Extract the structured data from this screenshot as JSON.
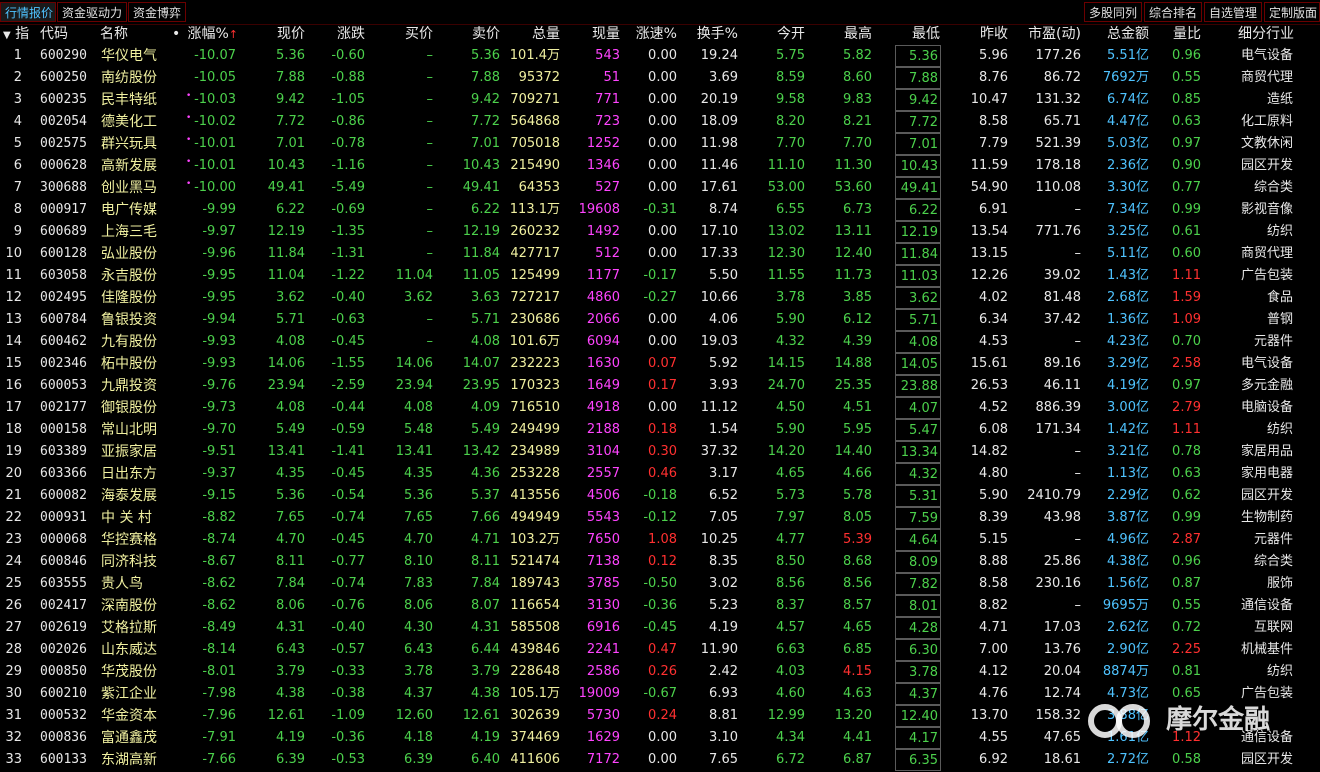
{
  "tabs_left": [
    {
      "label": "行情报价",
      "active": true
    },
    {
      "label": "资金驱动力",
      "active": false
    },
    {
      "label": "资金博弈",
      "active": false
    }
  ],
  "tabs_right": [
    {
      "label": "多股同列"
    },
    {
      "label": "综合排名"
    },
    {
      "label": "自选管理"
    },
    {
      "label": "定制版面"
    }
  ],
  "headers": {
    "idx": "指",
    "code": "代码",
    "name": "名称",
    "pct": "涨幅%",
    "price": "现价",
    "change": "涨跌",
    "bid": "买价",
    "ask": "卖价",
    "volume": "总量",
    "cur_vol": "现量",
    "speed": "涨速%",
    "turnover": "换手%",
    "open": "今开",
    "high": "最高",
    "low": "最低",
    "prev_close": "昨收",
    "pe": "市盈(动)",
    "amount": "总金额",
    "vol_ratio": "量比",
    "industry": "细分行业"
  },
  "sort_indicator": "↑",
  "rows": [
    {
      "idx": "1",
      "code": "600290",
      "name": "华仪电气",
      "pct": "-10.07",
      "price": "5.36",
      "change": "-0.60",
      "bid": "–",
      "ask": "5.36",
      "volume": "101.4万",
      "cur_vol": "543",
      "speed": "0.00",
      "turnover": "19.24",
      "open": "5.75",
      "high": "5.82",
      "low": "5.36",
      "prev_close": "5.96",
      "pe": "177.26",
      "amount_num": "5.51",
      "amount_unit": "亿",
      "vol_ratio": "0.96",
      "industry": "电气设备"
    },
    {
      "idx": "2",
      "code": "600250",
      "name": "南纺股份",
      "pct": "-10.05",
      "price": "7.88",
      "change": "-0.88",
      "bid": "–",
      "ask": "7.88",
      "volume": "95372",
      "cur_vol": "51",
      "speed": "0.00",
      "turnover": "3.69",
      "open": "8.59",
      "high": "8.60",
      "low": "7.88",
      "prev_close": "8.76",
      "pe": "86.72",
      "amount_num": "7692",
      "amount_unit": "万",
      "vol_ratio": "0.55",
      "industry": "商贸代理"
    },
    {
      "idx": "3",
      "code": "600235",
      "name": "民丰特纸",
      "pct": "-10.03",
      "price": "9.42",
      "change": "-1.05",
      "bid": "–",
      "ask": "9.42",
      "volume": "709271",
      "cur_vol": "771",
      "speed": "0.00",
      "turnover": "20.19",
      "open": "9.58",
      "high": "9.83",
      "low": "9.42",
      "prev_close": "10.47",
      "pe": "131.32",
      "amount_num": "6.74",
      "amount_unit": "亿",
      "vol_ratio": "0.85",
      "industry": "造纸"
    },
    {
      "idx": "4",
      "code": "002054",
      "name": "德美化工",
      "pct": "-10.02",
      "price": "7.72",
      "change": "-0.86",
      "bid": "–",
      "ask": "7.72",
      "volume": "564868",
      "cur_vol": "723",
      "speed": "0.00",
      "turnover": "18.09",
      "open": "8.20",
      "high": "8.21",
      "low": "7.72",
      "prev_close": "8.58",
      "pe": "65.71",
      "amount_num": "4.47",
      "amount_unit": "亿",
      "vol_ratio": "0.63",
      "industry": "化工原料"
    },
    {
      "idx": "5",
      "code": "002575",
      "name": "群兴玩具",
      "pct": "-10.01",
      "price": "7.01",
      "change": "-0.78",
      "bid": "–",
      "ask": "7.01",
      "volume": "705018",
      "cur_vol": "1252",
      "speed": "0.00",
      "turnover": "11.98",
      "open": "7.70",
      "high": "7.70",
      "low": "7.01",
      "prev_close": "7.79",
      "pe": "521.39",
      "amount_num": "5.03",
      "amount_unit": "亿",
      "vol_ratio": "0.97",
      "industry": "文教休闲"
    },
    {
      "idx": "6",
      "code": "000628",
      "name": "高新发展",
      "pct": "-10.01",
      "price": "10.43",
      "change": "-1.16",
      "bid": "–",
      "ask": "10.43",
      "volume": "215490",
      "cur_vol": "1346",
      "speed": "0.00",
      "turnover": "11.46",
      "open": "11.10",
      "high": "11.30",
      "low": "10.43",
      "prev_close": "11.59",
      "pe": "178.18",
      "amount_num": "2.36",
      "amount_unit": "亿",
      "vol_ratio": "0.90",
      "industry": "园区开发"
    },
    {
      "idx": "7",
      "code": "300688",
      "name": "创业黑马",
      "pct": "-10.00",
      "price": "49.41",
      "change": "-5.49",
      "bid": "–",
      "ask": "49.41",
      "volume": "64353",
      "cur_vol": "527",
      "speed": "0.00",
      "turnover": "17.61",
      "open": "53.00",
      "high": "53.60",
      "low": "49.41",
      "prev_close": "54.90",
      "pe": "110.08",
      "amount_num": "3.30",
      "amount_unit": "亿",
      "vol_ratio": "0.77",
      "industry": "综合类"
    },
    {
      "idx": "8",
      "code": "000917",
      "name": "电广传媒",
      "pct": "-9.99",
      "price": "6.22",
      "change": "-0.69",
      "bid": "–",
      "ask": "6.22",
      "volume": "113.1万",
      "cur_vol": "19608",
      "speed": "-0.31",
      "turnover": "8.74",
      "open": "6.55",
      "high": "6.73",
      "low": "6.22",
      "prev_close": "6.91",
      "pe": "–",
      "amount_num": "7.34",
      "amount_unit": "亿",
      "vol_ratio": "0.99",
      "industry": "影视音像"
    },
    {
      "idx": "9",
      "code": "600689",
      "name": "上海三毛",
      "pct": "-9.97",
      "price": "12.19",
      "change": "-1.35",
      "bid": "–",
      "ask": "12.19",
      "volume": "260232",
      "cur_vol": "1492",
      "speed": "0.00",
      "turnover": "17.10",
      "open": "13.02",
      "high": "13.11",
      "low": "12.19",
      "prev_close": "13.54",
      "pe": "771.76",
      "amount_num": "3.25",
      "amount_unit": "亿",
      "vol_ratio": "0.61",
      "industry": "纺织"
    },
    {
      "idx": "10",
      "code": "600128",
      "name": "弘业股份",
      "pct": "-9.96",
      "price": "11.84",
      "change": "-1.31",
      "bid": "–",
      "ask": "11.84",
      "volume": "427717",
      "cur_vol": "512",
      "speed": "0.00",
      "turnover": "17.33",
      "open": "12.30",
      "high": "12.40",
      "low": "11.84",
      "prev_close": "13.15",
      "pe": "–",
      "amount_num": "5.11",
      "amount_unit": "亿",
      "vol_ratio": "0.60",
      "industry": "商贸代理"
    },
    {
      "idx": "11",
      "code": "603058",
      "name": "永吉股份",
      "pct": "-9.95",
      "price": "11.04",
      "change": "-1.22",
      "bid": "11.04",
      "ask": "11.05",
      "volume": "125499",
      "cur_vol": "1177",
      "speed": "-0.17",
      "turnover": "5.50",
      "open": "11.55",
      "high": "11.73",
      "low": "11.03",
      "prev_close": "12.26",
      "pe": "39.02",
      "amount_num": "1.43",
      "amount_unit": "亿",
      "vol_ratio": "1.11",
      "industry": "广告包装"
    },
    {
      "idx": "12",
      "code": "002495",
      "name": "佳隆股份",
      "pct": "-9.95",
      "price": "3.62",
      "change": "-0.40",
      "bid": "3.62",
      "ask": "3.63",
      "volume": "727217",
      "cur_vol": "4860",
      "speed": "-0.27",
      "turnover": "10.66",
      "open": "3.78",
      "high": "3.85",
      "low": "3.62",
      "prev_close": "4.02",
      "pe": "81.48",
      "amount_num": "2.68",
      "amount_unit": "亿",
      "vol_ratio": "1.59",
      "industry": "食品"
    },
    {
      "idx": "13",
      "code": "600784",
      "name": "鲁银投资",
      "pct": "-9.94",
      "price": "5.71",
      "change": "-0.63",
      "bid": "–",
      "ask": "5.71",
      "volume": "230686",
      "cur_vol": "2066",
      "speed": "0.00",
      "turnover": "4.06",
      "open": "5.90",
      "high": "6.12",
      "low": "5.71",
      "prev_close": "6.34",
      "pe": "37.42",
      "amount_num": "1.36",
      "amount_unit": "亿",
      "vol_ratio": "1.09",
      "industry": "普钢"
    },
    {
      "idx": "14",
      "code": "600462",
      "name": "九有股份",
      "pct": "-9.93",
      "price": "4.08",
      "change": "-0.45",
      "bid": "–",
      "ask": "4.08",
      "volume": "101.6万",
      "cur_vol": "6094",
      "speed": "0.00",
      "turnover": "19.03",
      "open": "4.32",
      "high": "4.39",
      "low": "4.08",
      "prev_close": "4.53",
      "pe": "–",
      "amount_num": "4.23",
      "amount_unit": "亿",
      "vol_ratio": "0.70",
      "industry": "元器件"
    },
    {
      "idx": "15",
      "code": "002346",
      "name": "柘中股份",
      "pct": "-9.93",
      "price": "14.06",
      "change": "-1.55",
      "bid": "14.06",
      "ask": "14.07",
      "volume": "232223",
      "cur_vol": "1630",
      "speed": "0.07",
      "turnover": "5.92",
      "open": "14.15",
      "high": "14.88",
      "low": "14.05",
      "prev_close": "15.61",
      "pe": "89.16",
      "amount_num": "3.29",
      "amount_unit": "亿",
      "vol_ratio": "2.58",
      "industry": "电气设备"
    },
    {
      "idx": "16",
      "code": "600053",
      "name": "九鼎投资",
      "pct": "-9.76",
      "price": "23.94",
      "change": "-2.59",
      "bid": "23.94",
      "ask": "23.95",
      "volume": "170323",
      "cur_vol": "1649",
      "speed": "0.17",
      "turnover": "3.93",
      "open": "24.70",
      "high": "25.35",
      "low": "23.88",
      "prev_close": "26.53",
      "pe": "46.11",
      "amount_num": "4.19",
      "amount_unit": "亿",
      "vol_ratio": "0.97",
      "industry": "多元金融"
    },
    {
      "idx": "17",
      "code": "002177",
      "name": "御银股份",
      "pct": "-9.73",
      "price": "4.08",
      "change": "-0.44",
      "bid": "4.08",
      "ask": "4.09",
      "volume": "716510",
      "cur_vol": "4918",
      "speed": "0.00",
      "turnover": "11.12",
      "open": "4.50",
      "high": "4.51",
      "low": "4.07",
      "prev_close": "4.52",
      "pe": "886.39",
      "amount_num": "3.00",
      "amount_unit": "亿",
      "vol_ratio": "2.79",
      "industry": "电脑设备"
    },
    {
      "idx": "18",
      "code": "000158",
      "name": "常山北明",
      "pct": "-9.70",
      "price": "5.49",
      "change": "-0.59",
      "bid": "5.48",
      "ask": "5.49",
      "volume": "249499",
      "cur_vol": "2188",
      "speed": "0.18",
      "turnover": "1.54",
      "open": "5.90",
      "high": "5.95",
      "low": "5.47",
      "prev_close": "6.08",
      "pe": "171.34",
      "amount_num": "1.42",
      "amount_unit": "亿",
      "vol_ratio": "1.11",
      "industry": "纺织"
    },
    {
      "idx": "19",
      "code": "603389",
      "name": "亚振家居",
      "pct": "-9.51",
      "price": "13.41",
      "change": "-1.41",
      "bid": "13.41",
      "ask": "13.42",
      "volume": "234989",
      "cur_vol": "3104",
      "speed": "0.30",
      "turnover": "37.32",
      "open": "14.20",
      "high": "14.40",
      "low": "13.34",
      "prev_close": "14.82",
      "pe": "–",
      "amount_num": "3.21",
      "amount_unit": "亿",
      "vol_ratio": "0.78",
      "industry": "家居用品"
    },
    {
      "idx": "20",
      "code": "603366",
      "name": "日出东方",
      "pct": "-9.37",
      "price": "4.35",
      "change": "-0.45",
      "bid": "4.35",
      "ask": "4.36",
      "volume": "253228",
      "cur_vol": "2557",
      "speed": "0.46",
      "turnover": "3.17",
      "open": "4.65",
      "high": "4.66",
      "low": "4.32",
      "prev_close": "4.80",
      "pe": "–",
      "amount_num": "1.13",
      "amount_unit": "亿",
      "vol_ratio": "0.63",
      "industry": "家用电器"
    },
    {
      "idx": "21",
      "code": "600082",
      "name": "海泰发展",
      "pct": "-9.15",
      "price": "5.36",
      "change": "-0.54",
      "bid": "5.36",
      "ask": "5.37",
      "volume": "413556",
      "cur_vol": "4506",
      "speed": "-0.18",
      "turnover": "6.52",
      "open": "5.73",
      "high": "5.78",
      "low": "5.31",
      "prev_close": "5.90",
      "pe": "2410.79",
      "amount_num": "2.29",
      "amount_unit": "亿",
      "vol_ratio": "0.62",
      "industry": "园区开发"
    },
    {
      "idx": "22",
      "code": "000931",
      "name": "中 关 村",
      "pct": "-8.82",
      "price": "7.65",
      "change": "-0.74",
      "bid": "7.65",
      "ask": "7.66",
      "volume": "494949",
      "cur_vol": "5543",
      "speed": "-0.12",
      "turnover": "7.05",
      "open": "7.97",
      "high": "8.05",
      "low": "7.59",
      "prev_close": "8.39",
      "pe": "43.98",
      "amount_num": "3.87",
      "amount_unit": "亿",
      "vol_ratio": "0.99",
      "industry": "生物制药"
    },
    {
      "idx": "23",
      "code": "000068",
      "name": "华控赛格",
      "pct": "-8.74",
      "price": "4.70",
      "change": "-0.45",
      "bid": "4.70",
      "ask": "4.71",
      "volume": "103.2万",
      "cur_vol": "7650",
      "speed": "1.08",
      "turnover": "10.25",
      "open": "4.77",
      "high": "5.39",
      "low": "4.64",
      "prev_close": "5.15",
      "pe": "–",
      "amount_num": "4.96",
      "amount_unit": "亿",
      "vol_ratio": "2.87",
      "industry": "元器件"
    },
    {
      "idx": "24",
      "code": "600846",
      "name": "同济科技",
      "pct": "-8.67",
      "price": "8.11",
      "change": "-0.77",
      "bid": "8.10",
      "ask": "8.11",
      "volume": "521474",
      "cur_vol": "7138",
      "speed": "0.12",
      "turnover": "8.35",
      "open": "8.50",
      "high": "8.68",
      "low": "8.09",
      "prev_close": "8.88",
      "pe": "25.86",
      "amount_num": "4.38",
      "amount_unit": "亿",
      "vol_ratio": "0.96",
      "industry": "综合类"
    },
    {
      "idx": "25",
      "code": "603555",
      "name": "贵人鸟",
      "pct": "-8.62",
      "price": "7.84",
      "change": "-0.74",
      "bid": "7.83",
      "ask": "7.84",
      "volume": "189743",
      "cur_vol": "3785",
      "speed": "-0.50",
      "turnover": "3.02",
      "open": "8.56",
      "high": "8.56",
      "low": "7.82",
      "prev_close": "8.58",
      "pe": "230.16",
      "amount_num": "1.56",
      "amount_unit": "亿",
      "vol_ratio": "0.87",
      "industry": "服饰"
    },
    {
      "idx": "26",
      "code": "002417",
      "name": "深南股份",
      "pct": "-8.62",
      "price": "8.06",
      "change": "-0.76",
      "bid": "8.06",
      "ask": "8.07",
      "volume": "116654",
      "cur_vol": "3130",
      "speed": "-0.36",
      "turnover": "5.23",
      "open": "8.37",
      "high": "8.57",
      "low": "8.01",
      "prev_close": "8.82",
      "pe": "–",
      "amount_num": "9695",
      "amount_unit": "万",
      "vol_ratio": "0.55",
      "industry": "通信设备"
    },
    {
      "idx": "27",
      "code": "002619",
      "name": "艾格拉斯",
      "pct": "-8.49",
      "price": "4.31",
      "change": "-0.40",
      "bid": "4.30",
      "ask": "4.31",
      "volume": "585508",
      "cur_vol": "6916",
      "speed": "-0.45",
      "turnover": "4.19",
      "open": "4.57",
      "high": "4.65",
      "low": "4.28",
      "prev_close": "4.71",
      "pe": "17.03",
      "amount_num": "2.62",
      "amount_unit": "亿",
      "vol_ratio": "0.72",
      "industry": "互联网"
    },
    {
      "idx": "28",
      "code": "002026",
      "name": "山东威达",
      "pct": "-8.14",
      "price": "6.43",
      "change": "-0.57",
      "bid": "6.43",
      "ask": "6.44",
      "volume": "439846",
      "cur_vol": "2241",
      "speed": "0.47",
      "turnover": "11.90",
      "open": "6.63",
      "high": "6.85",
      "low": "6.30",
      "prev_close": "7.00",
      "pe": "13.76",
      "amount_num": "2.90",
      "amount_unit": "亿",
      "vol_ratio": "2.25",
      "industry": "机械基件"
    },
    {
      "idx": "29",
      "code": "000850",
      "name": "华茂股份",
      "pct": "-8.01",
      "price": "3.79",
      "change": "-0.33",
      "bid": "3.78",
      "ask": "3.79",
      "volume": "228648",
      "cur_vol": "2586",
      "speed": "0.26",
      "turnover": "2.42",
      "open": "4.03",
      "high": "4.15",
      "low": "3.78",
      "prev_close": "4.12",
      "pe": "20.04",
      "amount_num": "8874",
      "amount_unit": "万",
      "vol_ratio": "0.81",
      "industry": "纺织"
    },
    {
      "idx": "30",
      "code": "600210",
      "name": "紫江企业",
      "pct": "-7.98",
      "price": "4.38",
      "change": "-0.38",
      "bid": "4.37",
      "ask": "4.38",
      "volume": "105.1万",
      "cur_vol": "19009",
      "speed": "-0.67",
      "turnover": "6.93",
      "open": "4.60",
      "high": "4.63",
      "low": "4.37",
      "prev_close": "4.76",
      "pe": "12.74",
      "amount_num": "4.73",
      "amount_unit": "亿",
      "vol_ratio": "0.65",
      "industry": "广告包装"
    },
    {
      "idx": "31",
      "code": "000532",
      "name": "华金资本",
      "pct": "-7.96",
      "price": "12.61",
      "change": "-1.09",
      "bid": "12.60",
      "ask": "12.61",
      "volume": "302639",
      "cur_vol": "5730",
      "speed": "0.24",
      "turnover": "8.81",
      "open": "12.99",
      "high": "13.20",
      "low": "12.40",
      "prev_close": "13.70",
      "pe": "158.32",
      "amount_num": "3.88",
      "amount_unit": "亿",
      "vol_ratio": "",
      "industry": ""
    },
    {
      "idx": "32",
      "code": "000836",
      "name": "富通鑫茂",
      "pct": "-7.91",
      "price": "4.19",
      "change": "-0.36",
      "bid": "4.18",
      "ask": "4.19",
      "volume": "374469",
      "cur_vol": "1629",
      "speed": "0.00",
      "turnover": "3.10",
      "open": "4.34",
      "high": "4.41",
      "low": "4.17",
      "prev_close": "4.55",
      "pe": "47.65",
      "amount_num": "1.61",
      "amount_unit": "亿",
      "vol_ratio": "1.12",
      "industry": "通信设备"
    },
    {
      "idx": "33",
      "code": "600133",
      "name": "东湖高新",
      "pct": "-7.66",
      "price": "6.39",
      "change": "-0.53",
      "bid": "6.39",
      "ask": "6.40",
      "volume": "411606",
      "cur_vol": "7172",
      "speed": "0.00",
      "turnover": "7.65",
      "open": "6.72",
      "high": "6.87",
      "low": "6.35",
      "prev_close": "6.92",
      "pe": "18.61",
      "amount_num": "2.72",
      "amount_unit": "亿",
      "vol_ratio": "0.58",
      "industry": "园区开发"
    }
  ],
  "watermark": "摩尔金融",
  "colors": {
    "down": "#4cd14c",
    "up": "#ff3030",
    "volume": "#ff44ff",
    "amount": "#4fc3ff",
    "name": "#f0f0a0",
    "background": "#000000"
  }
}
